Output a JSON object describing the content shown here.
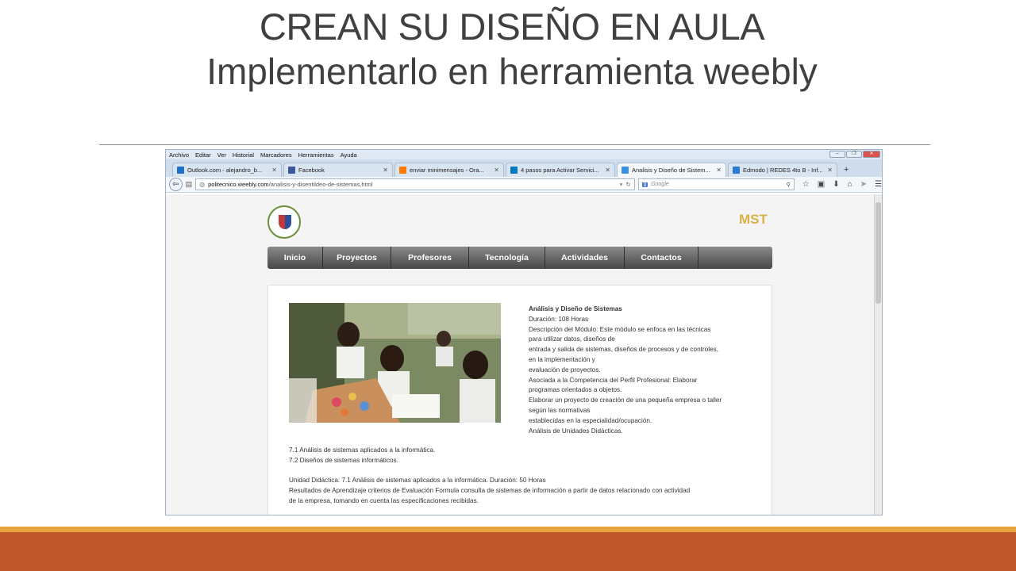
{
  "slide": {
    "title_line1": "CREAN SU DISEÑO EN AULA",
    "title_line2": "Implementarlo en herramienta weebly"
  },
  "browser": {
    "menu": [
      "Archivo",
      "Editar",
      "Ver",
      "Historial",
      "Marcadores",
      "Herramientas",
      "Ayuda"
    ],
    "tabs": [
      {
        "label": "Outlook.com - alejandro_b...",
        "icon": "outlook-icon",
        "color": "#1f6fc5"
      },
      {
        "label": "Facebook",
        "icon": "facebook-icon",
        "color": "#3b5998"
      },
      {
        "label": "enviar minimensajes - Ora...",
        "icon": "orange-icon",
        "color": "#ff7900"
      },
      {
        "label": "4 pasos para Activar Servici...",
        "icon": "trello-icon",
        "color": "#0079bf"
      },
      {
        "label": "Analisis y Diseño de Sistem...",
        "icon": "weebly-icon",
        "color": "#3a8ee6"
      },
      {
        "label": "Edmodo | REDES 4to B - Inf...",
        "icon": "edmodo-icon",
        "color": "#2a7bd5"
      }
    ],
    "url_host": "politecnico.weebly.com",
    "url_path": "/analisis-y-disentildeo-de-sistemas.html",
    "search_placeholder": "Google",
    "search_engine_badge": "g"
  },
  "site": {
    "brand": "MST",
    "nav": [
      "Inicio",
      "Proyectos",
      "Profesores",
      "Tecnología",
      "Actividades",
      "Contactos"
    ],
    "content": {
      "heading": "Análisis y Diseño de Sistemas",
      "lines": [
        "Duración: 108 Horas",
        "Descripción del Módulo: Este módulo se enfoca en las técnicas",
        "para utilizar datos, diseños de",
        "entrada y salida de sistemas, diseños de procesos y de controles,",
        "en la implementación y",
        "evaluación de proyectos.",
        "Asociada a la Competencia del Perfil Profesional: Elaborar",
        "programas orientados a objetos.",
        "Elaborar un proyecto de creación de una pequeña empresa o taller",
        "según las normativas",
        "establecidas en la especialidad/ocupación.",
        "Análisis de Unidades Didácticas."
      ],
      "units": [
        "7.1 Análisis de sistemas aplicados a la informática.",
        "7.2 Diseños de sistemas informáticos."
      ],
      "unit_detail": [
        "Unidad Didáctica: 7.1 Análisis de sistemas aplicados a la informática. Duración: 50 Horas",
        "Resultados de Aprendizaje criterios de Evaluación Formula consulta de sistemas de información a partir de datos relacionado con actividad",
        "de la empresa, tomando en cuenta las especificaciones recibidas."
      ]
    }
  },
  "colors": {
    "footer_thin": "#e8a33a",
    "footer_bar": "#c0562b",
    "brand": "#d9b04a",
    "title": "#404040"
  }
}
